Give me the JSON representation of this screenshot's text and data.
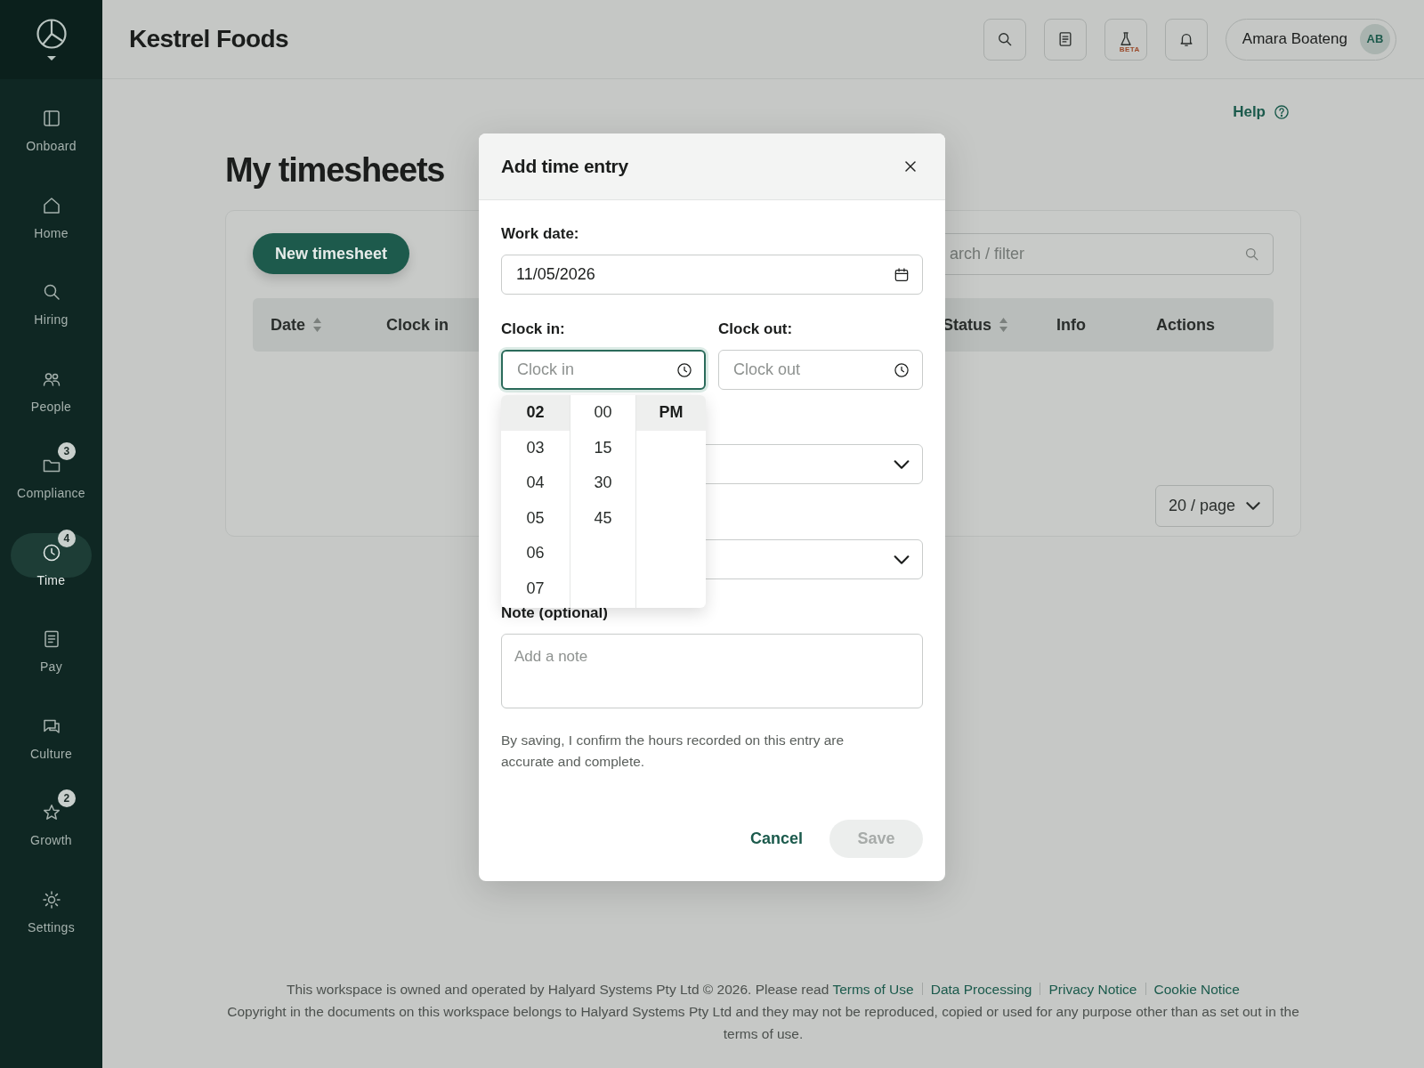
{
  "sidebar": {
    "items": [
      {
        "kind": "panel",
        "label": "Onboard",
        "selected": false
      },
      {
        "kind": "home",
        "label": "Home",
        "selected": false
      },
      {
        "kind": "search",
        "label": "Hiring",
        "selected": false
      },
      {
        "kind": "people",
        "label": "People",
        "selected": false
      },
      {
        "kind": "folder",
        "label": "Compliance",
        "badge": "3",
        "selected": false
      },
      {
        "kind": "clock",
        "label": "Time",
        "badge": "4",
        "selected": true
      },
      {
        "kind": "document",
        "label": "Pay",
        "selected": false
      },
      {
        "kind": "chat",
        "label": "Culture",
        "selected": false
      },
      {
        "kind": "star",
        "label": "Growth",
        "badge": "2",
        "selected": false
      },
      {
        "kind": "sun",
        "label": "Settings",
        "selected": false
      }
    ]
  },
  "header": {
    "title": "Kestrel Foods",
    "actions": [
      {
        "kind": "search"
      },
      {
        "kind": "document"
      },
      {
        "kind": "flask",
        "badge": "BETA"
      },
      {
        "kind": "bell"
      }
    ],
    "user": {
      "name": "Amara Boateng",
      "initials": "AB"
    }
  },
  "page": {
    "help_link": "Help",
    "title": "My timesheets",
    "new_button": "New timesheet",
    "search": {
      "placeholder": "arch / filter"
    },
    "table": {
      "columns": [
        {
          "label": "Date",
          "sortable": true
        },
        {
          "label": "Clock in",
          "sortable": false
        },
        {
          "label": "Status",
          "sortable": true
        },
        {
          "label": "Info",
          "sortable": false
        },
        {
          "label": "Actions",
          "sortable": false
        }
      ]
    },
    "page_size": "20 / page"
  },
  "modal": {
    "title": "Add time entry",
    "work_date": {
      "label": "Work date:",
      "value": "11/05/2026"
    },
    "clock_in": {
      "label": "Clock in:",
      "placeholder": "Clock in",
      "focused": true
    },
    "clock_out": {
      "label": "Clock out:",
      "placeholder": "Clock out",
      "focused": false
    },
    "time_picker": {
      "hours": [
        {
          "label": "02",
          "selected": true
        },
        {
          "label": "03",
          "selected": false
        },
        {
          "label": "04",
          "selected": false
        },
        {
          "label": "05",
          "selected": false
        },
        {
          "label": "06",
          "selected": false
        },
        {
          "label": "07",
          "selected": false
        }
      ],
      "minutes": [
        {
          "label": "00",
          "selected": false
        },
        {
          "label": "15",
          "selected": false
        },
        {
          "label": "30",
          "selected": false
        },
        {
          "label": "45",
          "selected": false
        }
      ],
      "periods": [
        {
          "label": "PM",
          "selected": true
        }
      ]
    },
    "note": {
      "label": "Note (optional)",
      "placeholder": "Add a note"
    },
    "disclaimer": "By saving, I confirm the hours recorded on this entry are accurate and complete.",
    "cancel": "Cancel",
    "save": {
      "label": "Save",
      "disabled": true
    }
  },
  "footer": {
    "notice": "This workspace is owned and operated by Halyard Systems Pty Ltd © 2026. Please read",
    "links": [
      "Terms of Use",
      "Data Processing",
      "Privacy Notice",
      "Cookie Notice"
    ],
    "copyright": "Copyright in the documents on this workspace belongs to Halyard Systems Pty Ltd and they may not be reproduced, copied or used for any purpose other than as set out in the terms of use."
  }
}
